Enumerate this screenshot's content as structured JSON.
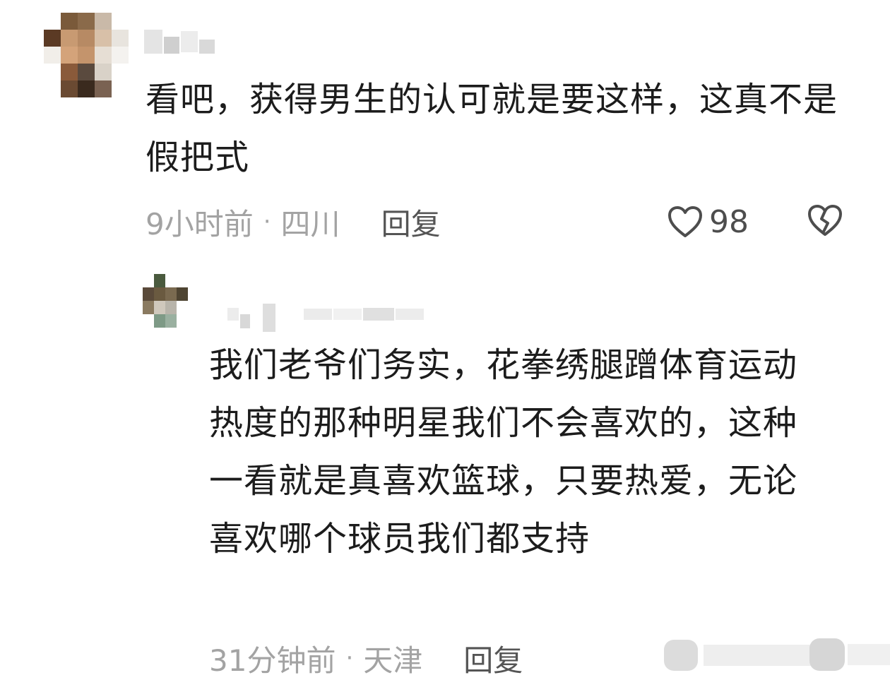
{
  "comments": [
    {
      "content": "看吧，获得男生的认可就是要这样，这真不是假把式",
      "time": "9小时前",
      "separator": "·",
      "location": "四川",
      "reply_label": "回复",
      "likes": "98"
    },
    {
      "content": "我们老爷们务实，花拳绣腿蹭体育运动热度的那种明星我们不会喜欢的，这种一看就是真喜欢篮球，只要热爱，无论喜欢哪个球员我们都支持",
      "time": "31分钟前",
      "separator": "·",
      "location": "天津",
      "reply_label": "回复"
    }
  ],
  "icons": {
    "like": "heart-outline-icon",
    "dislike": "broken-heart-icon"
  },
  "colors": {
    "text": "#1c1c1c",
    "meta": "#a3a3a3",
    "reply": "#555555",
    "icon": "#4d4d4d"
  }
}
